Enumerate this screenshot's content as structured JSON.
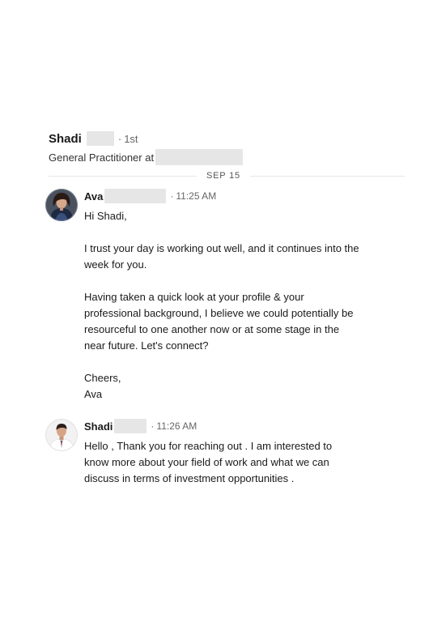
{
  "conversation": {
    "contact_name": "Shadi",
    "degree": "1st",
    "headline_prefix": "General Practitioner at",
    "date_divider": "SEP 15"
  },
  "messages": [
    {
      "sender": "Ava",
      "time": "11:25 AM",
      "paragraphs": [
        "Hi Shadi,",
        "I trust your day is working out well, and it continues into the week for you.",
        "Having taken a quick look at your profile & your professional background, I believe we could potentially be resourceful to one another now or at some stage in the near future. Let's connect?",
        "Cheers,\nAva"
      ]
    },
    {
      "sender": "Shadi",
      "time": "11:26 AM",
      "paragraphs": [
        "Hello , Thank you for reaching out . I am interested to know more about your field of work and what we can discuss in terms of investment opportunities ."
      ]
    }
  ],
  "colors": {
    "text_primary": "#1a1a1a",
    "text_secondary": "#666666",
    "divider": "#e6e6e6",
    "redaction": "#e6e6e6"
  }
}
